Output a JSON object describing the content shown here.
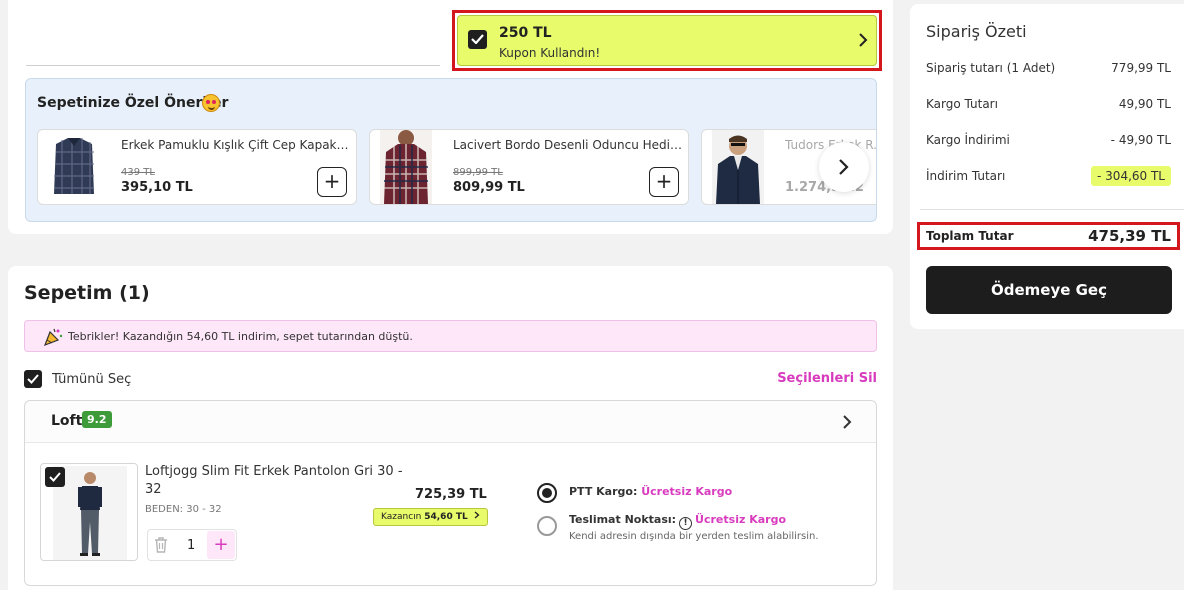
{
  "coupon": {
    "amount": "250 TL",
    "label": "Kupon Kullandın!"
  },
  "recommendations": {
    "title": "Sepetinize Özel Öneriler",
    "items": [
      {
        "name": "Erkek Pamuklu Kışlık Çift Cep Kapaklı R...",
        "old_price": "439 TL",
        "price": "395,10 TL",
        "add_label": "+"
      },
      {
        "name": "Lacivert Bordo Desenli Oduncu Hediye...",
        "old_price": "899,99 TL",
        "price": "809,99 TL",
        "add_label": "+"
      },
      {
        "name": "Tudors Erkek R...",
        "old_price": "",
        "price": "1.274,9...2",
        "add_label": ""
      }
    ]
  },
  "cart": {
    "title": "Sepetim (1)",
    "congrats": "Tebrikler! Kazandığın 54,60 TL indirim, sepet tutarından düştü.",
    "select_all": "Tümünü Seç",
    "delete_selected": "Seçilenleri Sil",
    "seller": {
      "name": "Loft",
      "rating": "9.2"
    },
    "product": {
      "name": "Loftjogg Slim Fit Erkek Pantolon Gri 30 - 32",
      "size": "BEDEN: 30 - 32",
      "price": "725,39 TL",
      "earn_prefix": "Kazancın",
      "earn_amount": "54,60 TL",
      "quantity": "1",
      "plus": "+"
    },
    "shipping": {
      "ptt_label": "PTT Kargo:",
      "ptt_free": "Ücretsiz Kargo",
      "teslimat_label": "Teslimat Noktası:",
      "teslimat_icon": "!",
      "teslimat_free": "Ücretsiz Kargo",
      "teslimat_sub": "Kendi adresin dışında bir yerden teslim alabilirsin."
    }
  },
  "summary": {
    "title": "Sipariş Özeti",
    "rows": [
      {
        "label": "Sipariş tutarı (1 Adet)",
        "value": "779,99 TL"
      },
      {
        "label": "Kargo Tutarı",
        "value": "49,90 TL"
      },
      {
        "label": "Kargo İndirimi",
        "value": "- 49,90 TL"
      },
      {
        "label": "İndirim Tutarı",
        "value": "- 304,60 TL"
      }
    ],
    "total_label": "Toplam Tutar",
    "total_value": "475,39 TL",
    "checkout": "Ödemeye Geç"
  },
  "colors": {
    "accent_pink": "#d83bbe",
    "coupon_yellow": "#e8fb6a",
    "highlight_red": "#d4161d",
    "rating_green": "#3d9b3a"
  },
  "icons": [
    "check-icon",
    "chevron-right-icon",
    "star-struck-emoji-icon",
    "party-popper-icon",
    "trash-icon",
    "info-icon"
  ]
}
